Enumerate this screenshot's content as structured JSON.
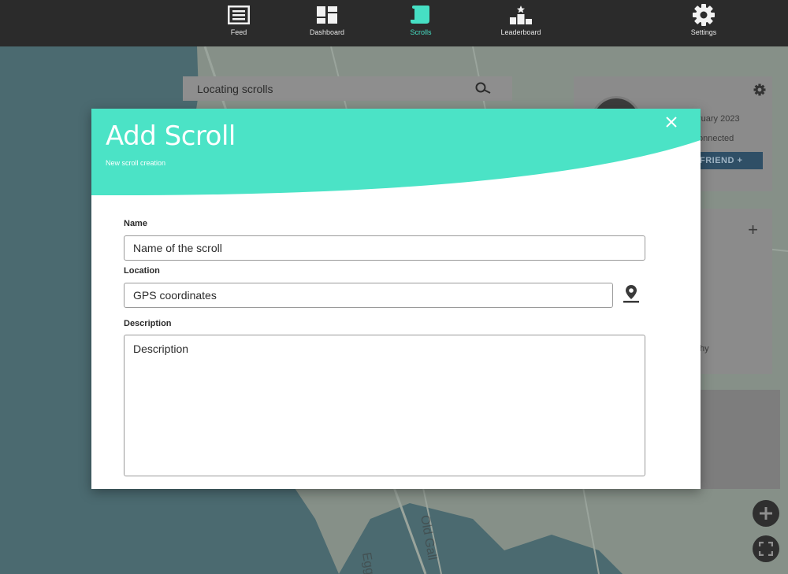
{
  "nav": {
    "items": [
      {
        "label": "Feed",
        "icon": "feed-icon"
      },
      {
        "label": "Dashboard",
        "icon": "dashboard-icon"
      },
      {
        "label": "Scrolls",
        "icon": "scroll-icon",
        "active": true
      },
      {
        "label": "Leaderboard",
        "icon": "leaderboard-icon"
      },
      {
        "label": "Settings",
        "icon": "gear-icon"
      }
    ],
    "accent_color": "#46dfc4"
  },
  "background": {
    "search_text": "Locating scrolls",
    "profile": {
      "date_fragment": "ruary 2023",
      "connected_fragment": "onnected",
      "friend_button": "FRIEND +"
    },
    "panel_fragment": "hy",
    "map_labels": [
      "Old Gall",
      "Egg"
    ]
  },
  "modal": {
    "title": "Add Scroll",
    "subtitle": "New scroll creation",
    "header_color": "#4be3c6",
    "fields": {
      "name_label": "Name",
      "name_placeholder": "Name of the scroll",
      "location_label": "Location",
      "location_placeholder": "GPS coordinates",
      "description_label": "Description",
      "description_placeholder": "Description"
    }
  }
}
